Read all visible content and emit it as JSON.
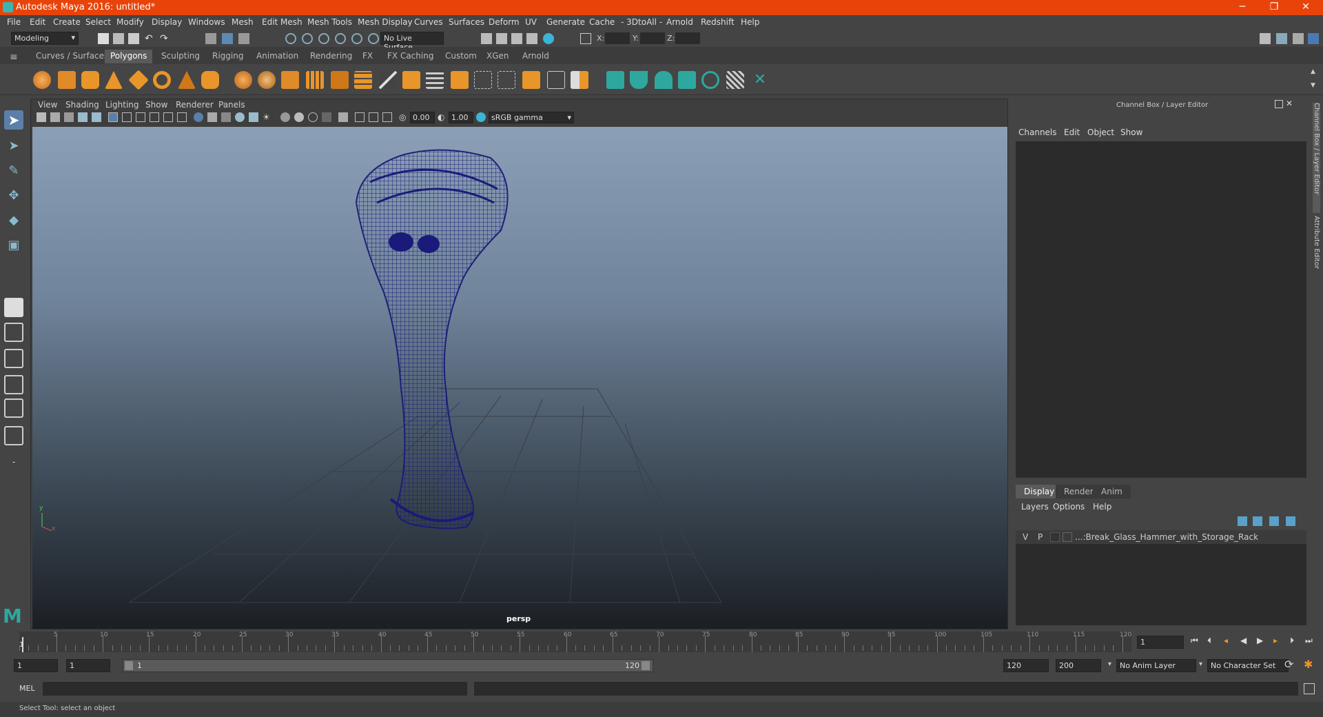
{
  "window": {
    "title": "Autodesk Maya 2016: untitled*",
    "minimize": "─",
    "maximize": "❐",
    "close": "✕"
  },
  "menus": [
    "File",
    "Edit",
    "Create",
    "Select",
    "Modify",
    "Display",
    "Windows",
    "Mesh",
    "Edit Mesh",
    "Mesh Tools",
    "Mesh Display",
    "Curves",
    "Surfaces",
    "Deform",
    "UV",
    "Generate",
    "Cache",
    "- 3DtoAll -",
    "Arnold",
    "Redshift",
    "Help"
  ],
  "status_line": {
    "mode": "Modeling",
    "live_surface": "No Live Surface",
    "x_label": "X:",
    "y_label": "Y:",
    "z_label": "Z:"
  },
  "shelf_tabs": [
    "Curves / Surfaces",
    "Polygons",
    "Sculpting",
    "Rigging",
    "Animation",
    "Rendering",
    "FX",
    "FX Caching",
    "Custom",
    "XGen",
    "Arnold"
  ],
  "shelf_active": "Polygons",
  "viewport": {
    "menu": [
      "View",
      "Shading",
      "Lighting",
      "Show",
      "Renderer",
      "Panels"
    ],
    "exposure": "0.00",
    "gamma": "1.00",
    "color_space": "sRGB gamma",
    "camera_label": "persp",
    "axis_y": "y",
    "axis_x": "x"
  },
  "channel_box": {
    "header": "Channel Box / Layer Editor",
    "menu": [
      "Channels",
      "Edit",
      "Object",
      "Show"
    ],
    "display_tabs": [
      "Display",
      "Render",
      "Anim"
    ],
    "display_active": "Display",
    "layer_menu": [
      "Layers",
      "Options",
      "Help"
    ],
    "layer": {
      "v": "V",
      "p": "P",
      "name": "...:Break_Glass_Hammer_with_Storage_Rack"
    }
  },
  "side_tabs": {
    "channel": "Channel Box / Layer Editor",
    "attribute": "Attribute Editor"
  },
  "timeline": {
    "ticks": [
      "5",
      "10",
      "15",
      "20",
      "25",
      "30",
      "35",
      "40",
      "45",
      "50",
      "55",
      "60",
      "65",
      "70",
      "75",
      "80",
      "85",
      "90",
      "95",
      "100",
      "105",
      "110",
      "115",
      "120"
    ],
    "start_marker": "1",
    "current_frame": "1"
  },
  "range": {
    "start": "1",
    "anim_start": "1",
    "range_start": "1",
    "range_end": "120",
    "anim_end_field": "120",
    "max_end": "200",
    "anim_layer": "No Anim Layer",
    "char_set": "No Character Set"
  },
  "command": {
    "lang": "MEL"
  },
  "help_line": "Select Tool: select an object",
  "colors": {
    "titlebar": "#e8440a",
    "wire": "#1a1a7a",
    "accent": "#2ea89f"
  }
}
